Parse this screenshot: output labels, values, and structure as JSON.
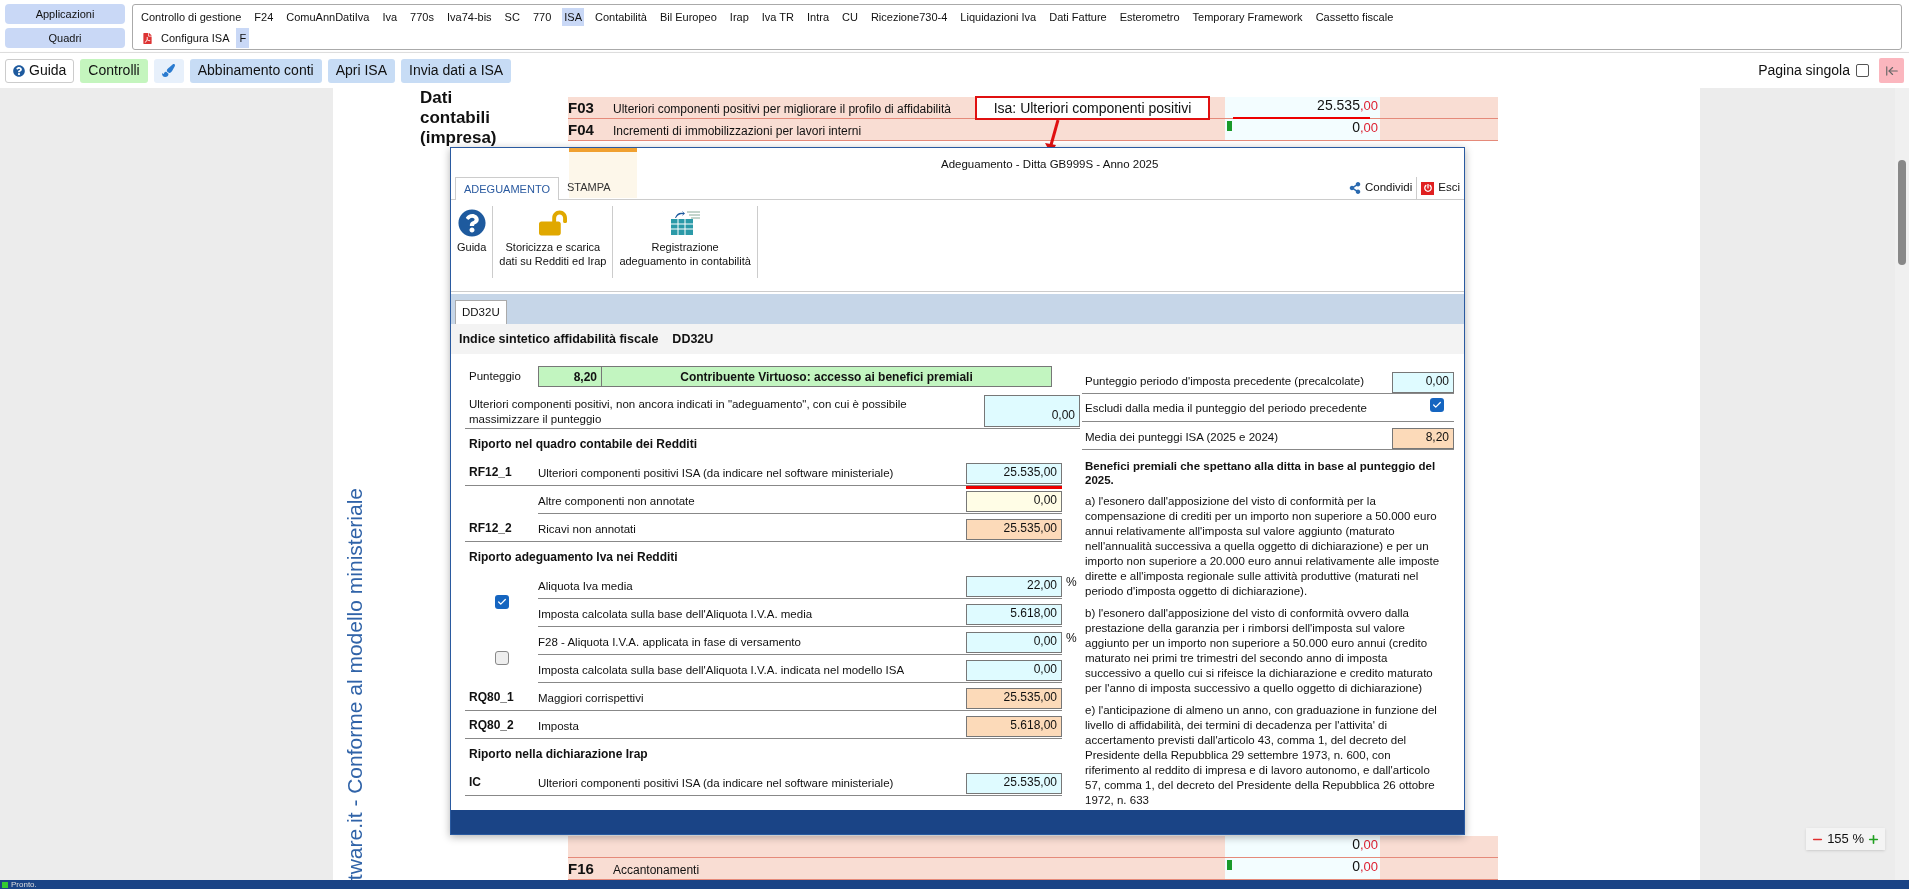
{
  "nav_buttons": [
    {
      "label": "Applicazioni"
    },
    {
      "label": "Quadri"
    }
  ],
  "menu_tabs": [
    {
      "label": "Controllo di gestione",
      "selected": false
    },
    {
      "label": "F24",
      "selected": false
    },
    {
      "label": "ComuAnnDatiIva",
      "selected": false
    },
    {
      "label": "Iva",
      "selected": false
    },
    {
      "label": "770s",
      "selected": false
    },
    {
      "label": "Iva74-bis",
      "selected": false
    },
    {
      "label": "SC",
      "selected": false
    },
    {
      "label": "770",
      "selected": false
    },
    {
      "label": "ISA",
      "selected": true
    },
    {
      "label": "Contabilità",
      "selected": false
    },
    {
      "label": "Bil Europeo",
      "selected": false
    },
    {
      "label": "Irap",
      "selected": false
    },
    {
      "label": "Iva TR",
      "selected": false
    },
    {
      "label": "Intra",
      "selected": false
    },
    {
      "label": "CU",
      "selected": false
    },
    {
      "label": "Ricezione730-4",
      "selected": false
    },
    {
      "label": "Liquidazioni Iva",
      "selected": false
    },
    {
      "label": "Dati Fatture",
      "selected": false
    },
    {
      "label": "Esterometro",
      "selected": false
    },
    {
      "label": "Temporary Framework",
      "selected": false
    },
    {
      "label": "Cassetto fiscale",
      "selected": false
    }
  ],
  "submenu": [
    {
      "label": "Configura ISA",
      "kind": "pdf",
      "selected": false
    },
    {
      "label": "F",
      "kind": "plain",
      "selected": true
    }
  ],
  "toolbar": {
    "buttons": [
      {
        "label": "Guida",
        "kind": "help"
      },
      {
        "label": "Controlli",
        "kind": "green"
      },
      {
        "kind": "brush"
      },
      {
        "label": "Abbinamento conti",
        "kind": "blue"
      },
      {
        "label": "Apri ISA",
        "kind": "blue"
      },
      {
        "label": "Invia dati a ISA",
        "kind": "blue"
      }
    ],
    "single_page": {
      "label": "Pagina singola",
      "checked": false
    }
  },
  "document": {
    "section_title": "Dati contabili (impresa)",
    "side_text": "tware.it - Conforme al modello ministeriale",
    "top_rows": [
      {
        "code": "F03",
        "label": "Ulteriori componenti positivi per migliorare il profilo di affidabilità",
        "value": "25.535",
        "decimals": ",00",
        "highlighted": true,
        "flagged": false
      },
      {
        "code": "F04",
        "label": "Incrementi di immobilizzazioni per lavori interni",
        "value": "0",
        "decimals": ",00",
        "highlighted": false,
        "flagged": true
      }
    ],
    "bottom_rows": [
      {
        "value": "0",
        "decimals": ",00",
        "highlighted": false,
        "flagged": false
      },
      {
        "code": "F16",
        "label": "Accantonamenti",
        "value": "0",
        "decimals": ",00",
        "highlighted": false,
        "flagged": true
      }
    ]
  },
  "callout": {
    "text": "Isa: Ulteriori componenti positivi"
  },
  "dialog": {
    "title": "Adeguamento - Ditta GB999S - Anno 2025",
    "tabs": [
      {
        "label": "ADEGUAMENTO",
        "selected": true
      },
      {
        "label": "STAMPA",
        "selected": false
      }
    ],
    "actions": [
      {
        "label": "Condividi",
        "kind": "share"
      },
      {
        "label": "Esci",
        "kind": "exit"
      }
    ],
    "ribbon": [
      {
        "lines": [
          "Guida"
        ],
        "kind": "help"
      },
      {
        "lines": [
          "Storicizza e scarica",
          "dati su Redditi ed Irap"
        ],
        "kind": "lock"
      },
      {
        "lines": [
          "Registrazione",
          "adeguamento in contabilità"
        ],
        "kind": "ledger"
      }
    ],
    "sheet_tabs": [
      {
        "label": "DD32U",
        "selected": true
      }
    ],
    "heading": {
      "title": "Indice sintetico affidabilità fiscale",
      "code": "DD32U"
    },
    "score": {
      "label": "Punteggio",
      "value": "8,20",
      "verdict": "Contribuente Virtuoso: accesso ai benefici premiali"
    },
    "left_rows": [
      {
        "kind": "note",
        "label": "Ulteriori componenti positivi, non ancora indicati in \"adeguamento\", con cui è possibile massimizzare il punteggio",
        "value": "0,00",
        "color": "#dffbff"
      },
      {
        "kind": "section",
        "label": "Riporto nel quadro contabile dei Redditi"
      },
      {
        "kind": "field",
        "code": "RF12_1",
        "label": "Ulteriori componenti positivi ISA (da indicare nel software ministeriale)",
        "value": "25.535,00",
        "color": "#dffbff",
        "highlighted": true
      },
      {
        "kind": "field",
        "label": "Altre componenti non annotate",
        "value": "0,00",
        "color": "#fffde6",
        "highlighted": false
      },
      {
        "kind": "field",
        "code": "RF12_2",
        "label": "Ricavi non annotati",
        "value": "25.535,00",
        "color": "#fcdab9",
        "highlighted": false
      },
      {
        "kind": "section",
        "label": "Riporto adeguamento Iva nei Redditi"
      },
      {
        "kind": "check_group",
        "checked": true,
        "rows": [
          {
            "label": "Aliquota Iva media",
            "value": "22,00",
            "unit": "%",
            "color": "#dffbff"
          },
          {
            "label": "Imposta calcolata sulla base dell'Aliquota I.V.A. media",
            "value": "5.618,00",
            "color": "#dffbff"
          }
        ]
      },
      {
        "kind": "check_group",
        "checked": false,
        "rows": [
          {
            "label": "F28 - Aliquota I.V.A. applicata in fase di versamento",
            "value": "0,00",
            "unit": "%",
            "color": "#dffbff"
          },
          {
            "label": "Imposta calcolata sulla base dell'Aliquota I.V.A. indicata nel modello ISA",
            "value": "0,00",
            "color": "#dffbff"
          }
        ]
      },
      {
        "kind": "field",
        "code": "RQ80_1",
        "label": "Maggiori corrispettivi",
        "value": "25.535,00",
        "color": "#fcdab9",
        "highlighted": false
      },
      {
        "kind": "field",
        "code": "RQ80_2",
        "label": "Imposta",
        "value": "5.618,00",
        "color": "#fcdab9",
        "highlighted": false
      },
      {
        "kind": "section",
        "label": "Riporto nella dichiarazione Irap"
      },
      {
        "kind": "field",
        "code": "IC",
        "label": "Ulteriori componenti positivi ISA (da indicare nel software ministeriale)",
        "value": "25.535,00",
        "color": "#dffbff",
        "highlighted": false
      }
    ],
    "right_rows": [
      {
        "kind": "field",
        "label": "Punteggio periodo d'imposta precedente (precalcolate)",
        "value": "0,00",
        "color": "#dffbff"
      },
      {
        "kind": "check",
        "label": "Escludi dalla media il punteggio del periodo precedente",
        "checked": true
      },
      {
        "kind": "field",
        "label": "Media dei punteggi ISA (2025 e 2024)",
        "value": "8,20",
        "color": "#fcdab9"
      }
    ],
    "benefits": {
      "title": "Benefici premiali che spettano alla ditta in base al punteggio del 2025.",
      "paragraphs": [
        "a) l'esonero dall'apposizione del visto di conformità per la compensazione di crediti per un importo non superiore a 50.000 euro annui relativamente all'imposta sul valore aggiunto (maturato nell'annualità successiva a quella oggetto di dichiarazione) e per un importo non superiore a 20.000 euro annui relativamente alle imposte dirette e all'imposta regionale sulle attività produttive (maturati nel periodo d'imposta oggetto di dichiarazione).",
        "b) l'esonero dall'apposizione del visto di conformità ovvero dalla prestazione della garanzia per i rimborsi dell'imposta sul valore aggiunto per un importo non superiore a 50.000 euro annui (credito maturato nei primi tre trimestri del secondo anno di imposta successivo a quello cui si rifeisce la dichiarazione e credito maturato per l'anno di imposta successivo a quello oggetto di dichiarazione)",
        "e) l'anticipazione di almeno un anno, con graduazione in funzione del livello di affidabilità, dei termini di decadenza per l'attivita' di accertamento previsti dall'articolo 43, comma 1, del decreto del Presidente della Repubblica 29 settembre 1973, n. 600, con riferimento al reddito di impresa e di lavoro autonomo, e dall'articolo 57, comma 1, del decreto del Presidente della Repubblica 26 ottobre 1972, n. 633"
      ]
    }
  },
  "zoom": {
    "value": "155 %"
  },
  "status": {
    "text": "Pronto."
  }
}
